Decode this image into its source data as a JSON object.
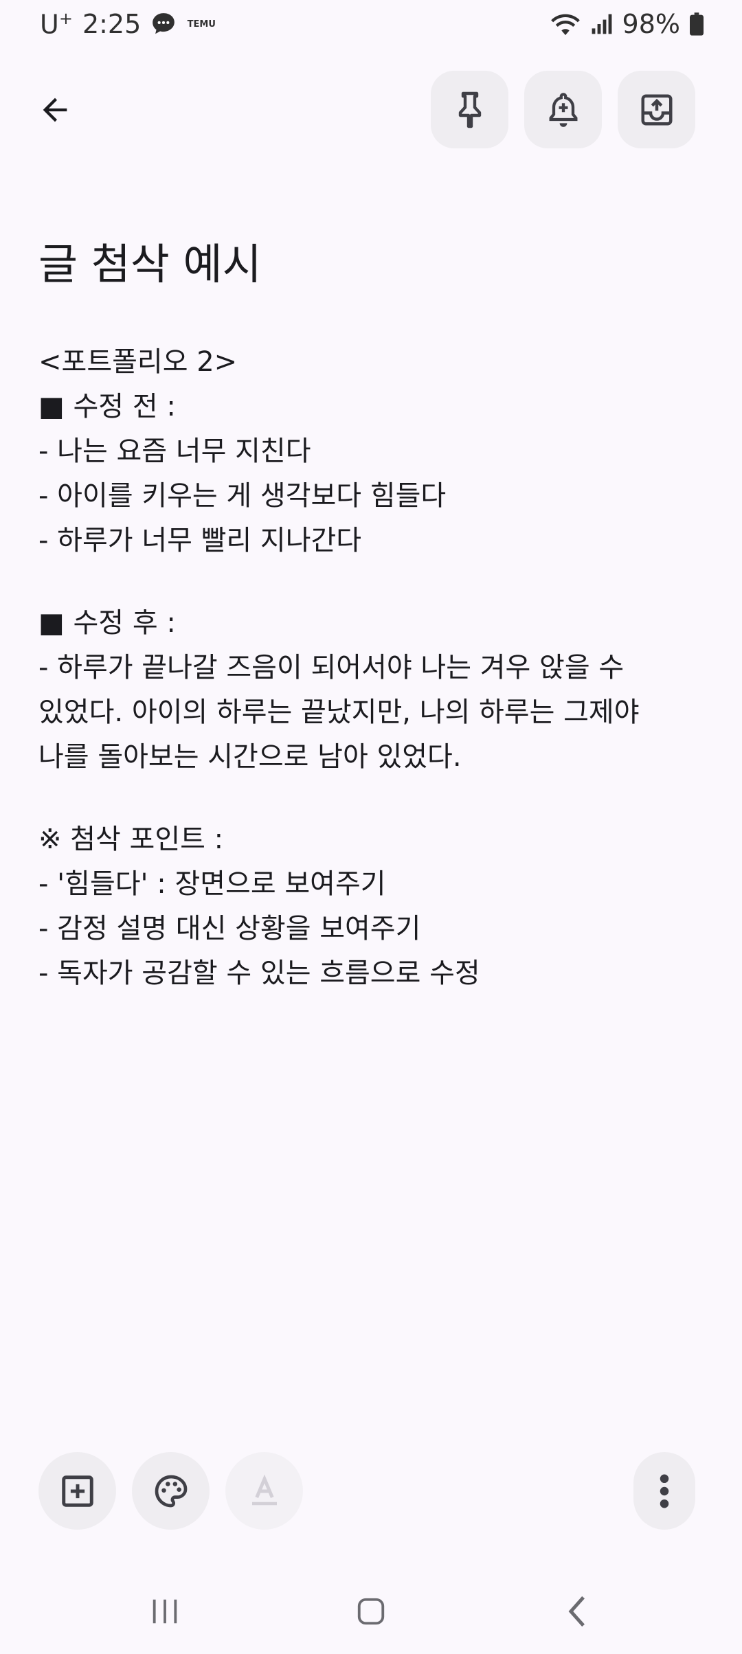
{
  "status_bar": {
    "carrier": "U",
    "carrier_sup": "+",
    "time": "2:25",
    "app_label": "TEMU",
    "battery": "98%"
  },
  "note": {
    "title": "글 첨삭 예시",
    "lines": [
      "<포트폴리오 2>",
      "■ 수정 전 :",
      "- 나는 요즘 너무 지친다",
      "- 아이를 키우는 게 생각보다 힘들다",
      "- 하루가 너무 빨리 지나간다",
      "",
      "■ 수정 후 :",
      "- 하루가 끝나갈 즈음이 되어서야 나는 겨우 앉을 수",
      "있었다. 아이의 하루는 끝났지만, 나의 하루는 그제야",
      "나를 돌아보는 시간으로 남아 있었다.",
      "",
      "※ 첨삭 포인트 :",
      "- '힘들다' : 장면으로 보여주기",
      "- 감정 설명 대신 상황을 보여주기",
      "- 독자가 공감할 수 있는 흐름으로 수정"
    ]
  },
  "icons": {
    "back": "arrow-left-icon",
    "pin": "pin-icon",
    "reminder": "bell-plus-icon",
    "archive": "archive-icon",
    "add": "add-box-icon",
    "palette": "palette-icon",
    "text_format": "text-format-icon",
    "more": "more-vert-icon"
  },
  "colors": {
    "background": "#fbf8fd",
    "button_bg": "#efedf1",
    "text": "#1b1b1f"
  }
}
